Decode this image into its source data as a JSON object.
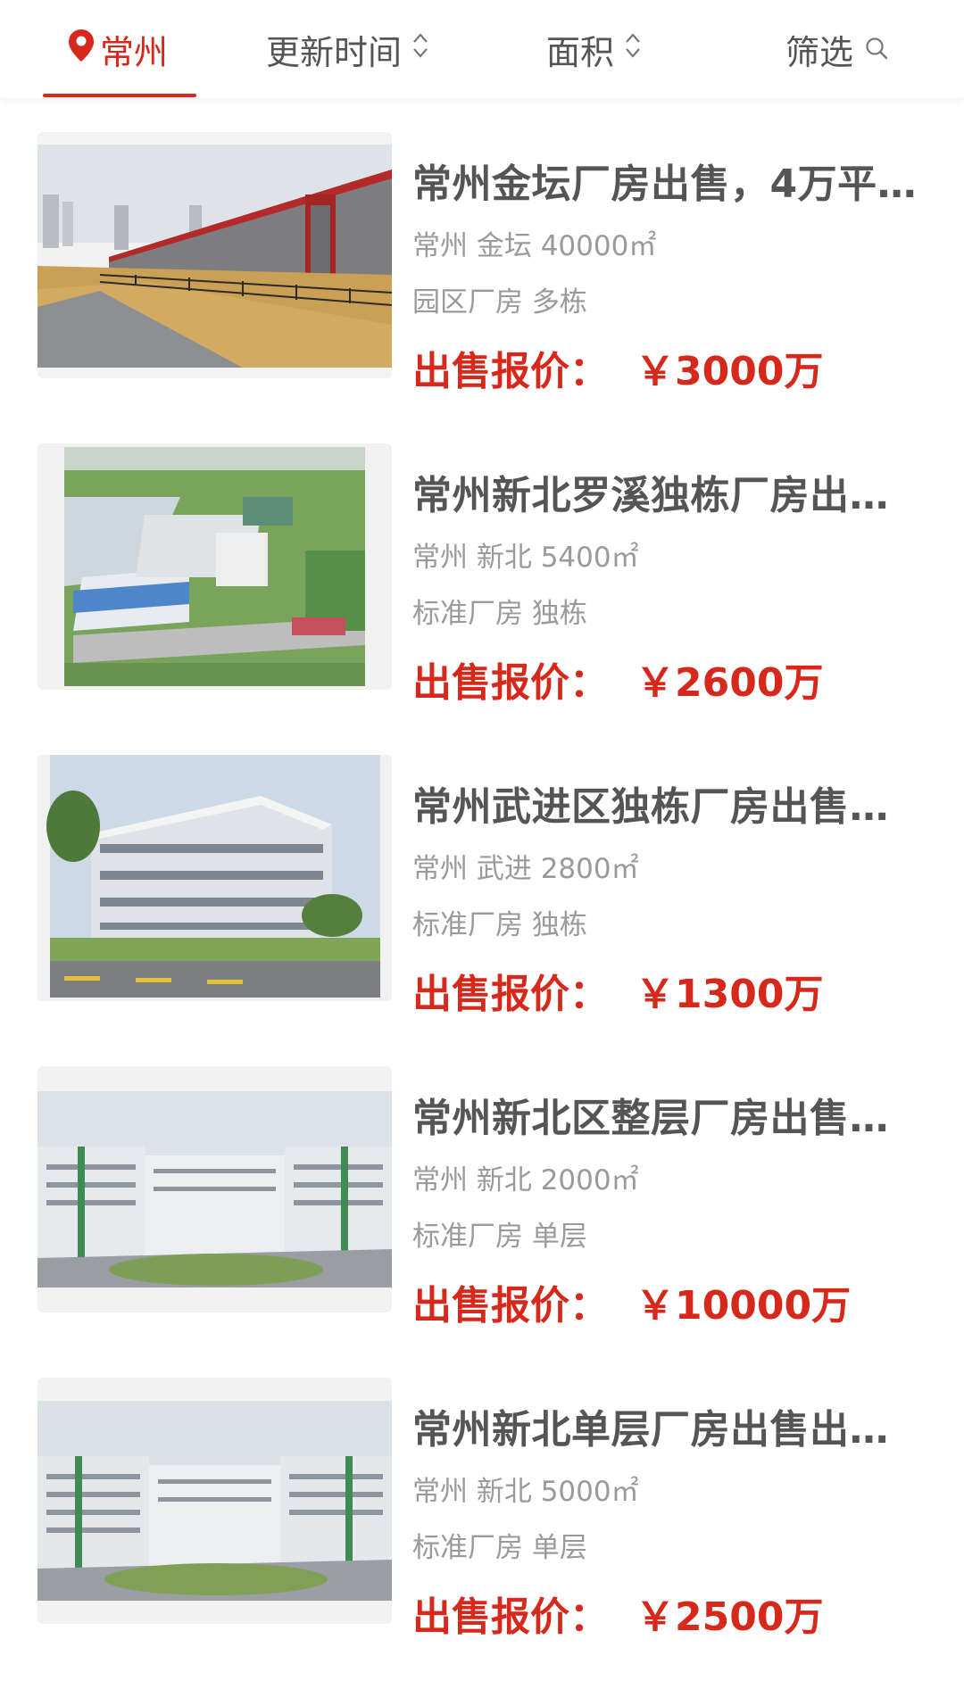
{
  "filter_bar": {
    "city": "常州",
    "sort_time": "更新时间",
    "sort_area": "面积",
    "filter": "筛选"
  },
  "colors": {
    "accent": "#d6281b",
    "title": "#555555",
    "meta": "#9a9a9a"
  },
  "listings": [
    {
      "title": "常州金坛厂房出售，4万平…",
      "location": "常州 金坛 40000㎡",
      "tags": "园区厂房 多栋",
      "price_label": "出售报价：",
      "price": "￥3000万"
    },
    {
      "title": "常州新北罗溪独栋厂房出…",
      "location": "常州 新北 5400㎡",
      "tags": "标准厂房 独栋",
      "price_label": "出售报价：",
      "price": "￥2600万"
    },
    {
      "title": "常州武进区独栋厂房出售…",
      "location": "常州 武进 2800㎡",
      "tags": "标准厂房 独栋",
      "price_label": "出售报价：",
      "price": "￥1300万"
    },
    {
      "title": "常州新北区整层厂房出售…",
      "location": "常州 新北 2000㎡",
      "tags": "标准厂房 单层",
      "price_label": "出售报价：",
      "price": "￥10000万"
    },
    {
      "title": "常州新北单层厂房出售出…",
      "location": "常州 新北 5000㎡",
      "tags": "标准厂房 单层",
      "price_label": "出售报价：",
      "price": "￥2500万"
    }
  ]
}
